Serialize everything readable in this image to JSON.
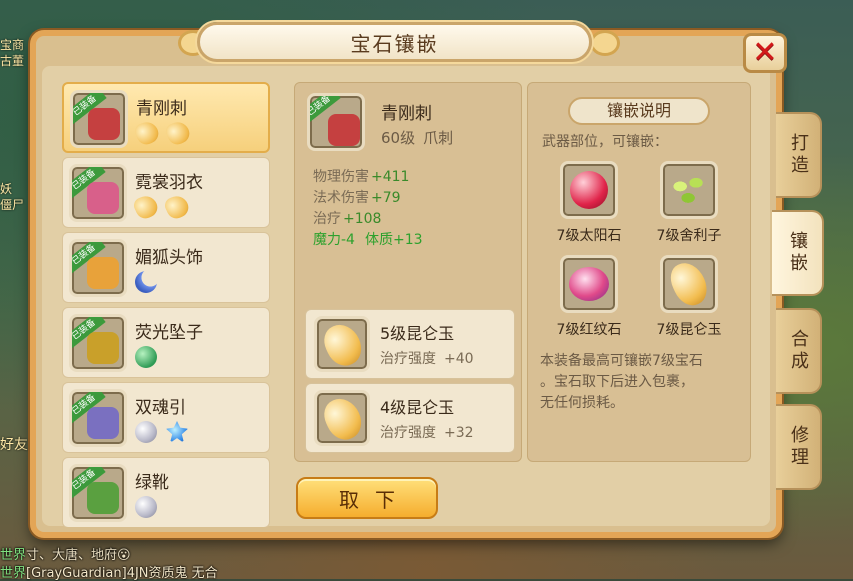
{
  "window": {
    "title": "宝石镶嵌",
    "close_label": "✕"
  },
  "tabs": [
    {
      "label": "打造",
      "active": false
    },
    {
      "label": "镶嵌",
      "active": true
    },
    {
      "label": "合成",
      "active": false
    },
    {
      "label": "修理",
      "active": false
    }
  ],
  "equipment_list": [
    {
      "name": "青刚刺",
      "badge": "已装备",
      "selected": true,
      "gems": [
        "jade",
        "jade"
      ],
      "art_color": "#c54040"
    },
    {
      "name": "霓裳羽衣",
      "badge": "已装备",
      "selected": false,
      "gems": [
        "jade",
        "jade"
      ],
      "art_color": "#d8608a"
    },
    {
      "name": "媚狐头饰",
      "badge": "已装备",
      "selected": false,
      "gems": [
        "moon"
      ],
      "art_color": "#e8a23a"
    },
    {
      "name": "荧光坠子",
      "badge": "已装备",
      "selected": false,
      "gems": [
        "green"
      ],
      "art_color": "#c9a02a"
    },
    {
      "name": "双魂引",
      "badge": "已装备",
      "selected": false,
      "gems": [
        "silver",
        "blue"
      ],
      "art_color": "#7a70c0"
    },
    {
      "name": "绿靴",
      "badge": "已装备",
      "selected": false,
      "gems": [
        "silver"
      ],
      "art_color": "#5aa040"
    }
  ],
  "detail": {
    "name": "青刚刺",
    "badge": "已装备",
    "level": "60级",
    "type": "爪刺",
    "stats": [
      {
        "key": "物理伤害",
        "value": "+411",
        "green": false
      },
      {
        "key": "法术伤害",
        "value": "+79",
        "green": false
      },
      {
        "key": "治疗",
        "value": "+108",
        "green": false
      }
    ],
    "special": {
      "key1": "魔力-4",
      "key2": "体质+13"
    },
    "inlaid_gems": [
      {
        "name": "5级昆仑玉",
        "effect": "治疗强度",
        "value": "+40"
      },
      {
        "name": "4级昆仑玉",
        "effect": "治疗强度",
        "value": "+32"
      }
    ],
    "remove_button": "取下"
  },
  "info": {
    "title": "镶嵌说明",
    "desc": "武器部位，可镶嵌：",
    "gems": [
      {
        "label": "7级太阳石",
        "icon": "sun-stone-icon"
      },
      {
        "label": "7级舍利子",
        "icon": "sarira-icon"
      },
      {
        "label": "7级红纹石",
        "icon": "red-vein-stone-icon"
      },
      {
        "label": "7级昆仑玉",
        "icon": "kunlun-jade-icon"
      }
    ],
    "note_lines": [
      "本装备最高可镶嵌7级宝石",
      "。宝石取下后进入包裹，",
      "无任何损耗。"
    ]
  },
  "background": {
    "chat": [
      {
        "channel": "世界",
        "text": "寸、大唐、地府😮"
      },
      {
        "channel": "世界",
        "text": "[GrayGuardian]4JN资质鬼 无合"
      }
    ],
    "side_texts": [
      "宝商",
      "古董",
      "妖",
      "僵尸",
      "好友"
    ]
  }
}
